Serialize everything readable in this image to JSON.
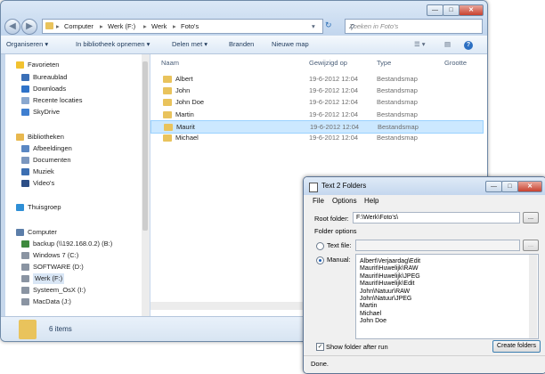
{
  "explorer": {
    "address": {
      "crumbs": [
        "Computer",
        "Werk (F:)",
        "Werk",
        "Foto's"
      ],
      "separators": [
        "▸",
        "▸",
        "▸",
        "▸"
      ]
    },
    "search_placeholder": "Zoeken in Foto's",
    "toolbar": [
      "Organiseren ▾",
      "In bibliotheek opnemen ▾",
      "Delen met ▾",
      "Branden",
      "Nieuwe map"
    ],
    "sidebar": [
      {
        "label": "Favorieten",
        "icon": "star-icon",
        "color": "#f2c230"
      },
      {
        "label": "Bureaublad",
        "icon": "desktop-icon",
        "color": "#3a6fb7"
      },
      {
        "label": "Downloads",
        "icon": "downloads-icon",
        "color": "#2f73c9"
      },
      {
        "label": "Recente locaties",
        "icon": "recent-places-icon",
        "color": "#8aa8cf"
      },
      {
        "label": "SkyDrive",
        "icon": "skydrive-icon",
        "color": "#3f7fd0"
      },
      {
        "label": "Bibliotheken",
        "icon": "libraries-icon",
        "color": "#e8b84f"
      },
      {
        "label": "Afbeeldingen",
        "icon": "pictures-icon",
        "color": "#5a87c3"
      },
      {
        "label": "Documenten",
        "icon": "documents-icon",
        "color": "#7b97bf"
      },
      {
        "label": "Muziek",
        "icon": "music-icon",
        "color": "#3d6fb2"
      },
      {
        "label": "Video's",
        "icon": "videos-icon",
        "color": "#2d4e86"
      },
      {
        "label": "Thuisgroep",
        "icon": "homegroup-icon",
        "color": "#2f8fd6"
      },
      {
        "label": "Computer",
        "icon": "computer-icon",
        "color": "#5c7ea9"
      },
      {
        "label": "backup (\\\\192.168.0.2) (B:)",
        "icon": "network-drive-icon",
        "color": "#3e8a3e"
      },
      {
        "label": "Windows 7 (C:)",
        "icon": "drive-icon",
        "color": "#8a94a2"
      },
      {
        "label": "SOFTWARE (D:)",
        "icon": "drive-icon",
        "color": "#8a94a2"
      },
      {
        "label": "Werk (F:)",
        "icon": "drive-icon",
        "color": "#8a94a2"
      },
      {
        "label": "Systeem_OsX (I:)",
        "icon": "drive-icon",
        "color": "#8a94a2"
      },
      {
        "label": "MacData (J:)",
        "icon": "drive-icon",
        "color": "#8a94a2"
      }
    ],
    "columns": [
      "Naam",
      "Gewijzigd op",
      "Type",
      "Grootte"
    ],
    "files": [
      {
        "name": "Albert",
        "date": "19-6-2012 12:04",
        "type": "Bestandsmap"
      },
      {
        "name": "John",
        "date": "19-6-2012 12:04",
        "type": "Bestandsmap"
      },
      {
        "name": "John Doe",
        "date": "19-6-2012 12:04",
        "type": "Bestandsmap"
      },
      {
        "name": "Martin",
        "date": "19-6-2012 12:04",
        "type": "Bestandsmap"
      },
      {
        "name": "Maurit",
        "date": "19-6-2012 12:04",
        "type": "Bestandsmap"
      },
      {
        "name": "Michael",
        "date": "19-6-2012 12:04",
        "type": "Bestandsmap"
      }
    ],
    "status": "6 items",
    "colors": {
      "selection": "#cce8ff",
      "folder": "#e9c35c"
    }
  },
  "dialog": {
    "title": "Text 2 Folders",
    "menu": [
      "File",
      "Options",
      "Help"
    ],
    "root_label": "Root folder:",
    "root_value": "F:\\Werk\\Foto's\\",
    "browse": "...",
    "options_label": "Folder options",
    "textfile_label": "Text file:",
    "manual_label": "Manual:",
    "manual_lines": [
      "Albert\\Verjaardag\\Edit",
      "Maurit\\Huwelijk\\RAW",
      "Maurit\\Huwelijk\\JPEG",
      "Maurit\\Huwelijk\\Edit",
      "John\\Natuur\\RAW",
      "John\\Natuur\\JPEG",
      "Martin",
      "Michael",
      "John Doe"
    ],
    "show_after_run": "Show folder after run",
    "show_after_run_checked": true,
    "create_button": "Create folders",
    "status": "Done."
  }
}
